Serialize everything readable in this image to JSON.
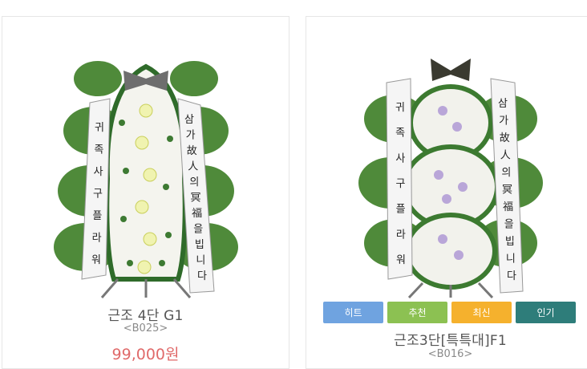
{
  "products": [
    {
      "name": "근조 4단 G1",
      "code": "<B025>",
      "price": "99,000원",
      "ribbon_left": [
        "귀",
        "족",
        "사",
        "구",
        "플",
        "라",
        "워"
      ],
      "ribbon_right": [
        "삼",
        "가",
        "故",
        "人",
        "의",
        "冥",
        "福",
        "을",
        "빕",
        "니",
        "다"
      ]
    },
    {
      "name": "근조3단[특특대]F1",
      "code": "<B016>",
      "ribbon_left": [
        "귀",
        "족",
        "사",
        "구",
        "플",
        "라",
        "워"
      ],
      "ribbon_right": [
        "삼",
        "가",
        "故",
        "人",
        "의",
        "冥",
        "福",
        "을",
        "빕",
        "니",
        "다"
      ],
      "badges": [
        {
          "label": "히트",
          "color": "#6fa3e0"
        },
        {
          "label": "추천",
          "color": "#8cc152"
        },
        {
          "label": "최신",
          "color": "#f5b12d"
        },
        {
          "label": "인기",
          "color": "#2e7d7a"
        }
      ]
    }
  ]
}
